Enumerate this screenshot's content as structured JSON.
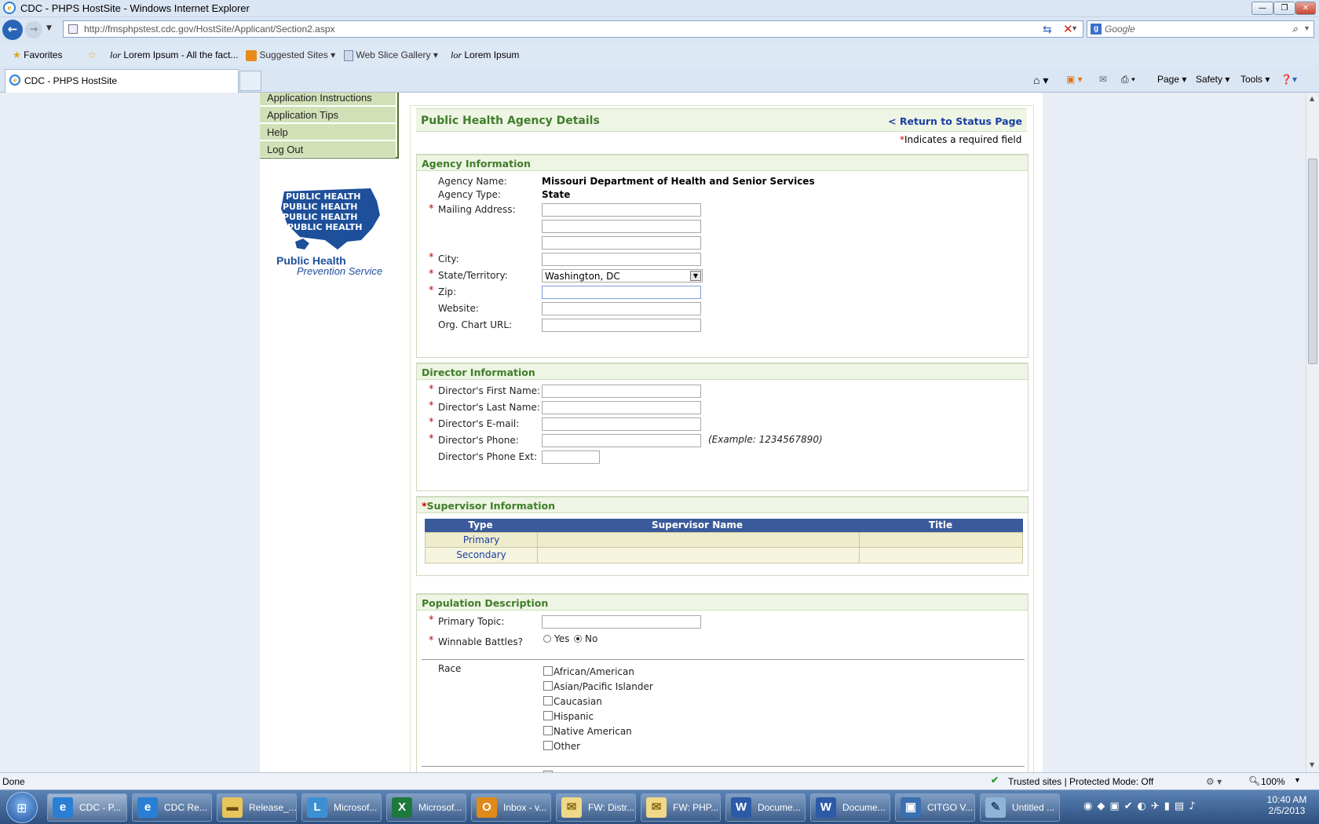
{
  "window": {
    "title": "CDC - PHPS HostSite - Windows Internet Explorer"
  },
  "nav": {
    "url": "http://fmsphpstest.cdc.gov/HostSite/Applicant/Section2.aspx",
    "search_placeholder": "Google"
  },
  "favorites": {
    "favorites_label": "Favorites",
    "items": [
      "Lorem Ipsum - All the fact...",
      "Suggested Sites",
      "Web Slice Gallery",
      "Lorem Ipsum"
    ]
  },
  "tab": {
    "label": "CDC - PHPS HostSite"
  },
  "commandbar": {
    "page": "Page",
    "safety": "Safety",
    "tools": "Tools"
  },
  "sidebar": {
    "menu": [
      "Application Instructions",
      "Application Tips",
      "Help",
      "Log Out"
    ],
    "logo_text": [
      "Public Health",
      "Prevention Service"
    ],
    "logo_words": "PUBLIC HEALTH PUBLIC HEALTH"
  },
  "page": {
    "title": "Public Health Agency Details",
    "return_link": "< Return to Status Page",
    "required_note": "Indicates a required field"
  },
  "agency": {
    "header": "Agency Information",
    "name_label": "Agency Name:",
    "name_value": "Missouri Department of Health and Senior Services",
    "type_label": "Agency Type:",
    "type_value": "State",
    "mailing_label": "Mailing Address:",
    "city_label": "City:",
    "state_label": "State/Territory:",
    "state_value": "Washington, DC",
    "zip_label": "Zip:",
    "website_label": "Website:",
    "org_label": "Org. Chart URL:"
  },
  "director": {
    "header": "Director Information",
    "first_label": "Director's First Name:",
    "last_label": "Director's Last Name:",
    "email_label": "Director's E-mail:",
    "phone_label": "Director's Phone:",
    "phone_example": "(Example: 1234567890)",
    "ext_label": "Director's Phone Ext:"
  },
  "supervisor": {
    "header": "Supervisor Information",
    "columns": [
      "Type",
      "Supervisor Name",
      "Title"
    ],
    "rows": [
      [
        "Primary",
        "",
        ""
      ],
      [
        "Secondary",
        "",
        ""
      ]
    ]
  },
  "population": {
    "header": "Population Description",
    "topic_label": "Primary Topic:",
    "winnable_label": "Winnable Battles?",
    "yes_label": "Yes",
    "no_label": "No",
    "selected": "No",
    "race_label": "Race",
    "race_options": [
      "African/American",
      "Asian/Pacific Islander",
      "Caucasian",
      "Hispanic",
      "Native American",
      "Other"
    ]
  },
  "status": {
    "left": "Done",
    "zone": "Trusted sites | Protected Mode: Off",
    "zoom": "100%"
  },
  "taskbar": {
    "items": [
      "CDC - P...",
      "CDC Re...",
      "Release_...",
      "Microsof...",
      "Microsof...",
      "Inbox - v...",
      "FW: Distr...",
      "FW: PHP...",
      "Docume...",
      "Docume...",
      "CITGO V...",
      "Untitled ..."
    ],
    "time": "10:40 AM",
    "date": "2/5/2013"
  },
  "colors": {
    "section_header": "#3f7d2a",
    "link": "#1a3fa3",
    "table_header": "#3a5a9a",
    "required": "#cc0000",
    "menu_bg": "#d2e0b7"
  }
}
